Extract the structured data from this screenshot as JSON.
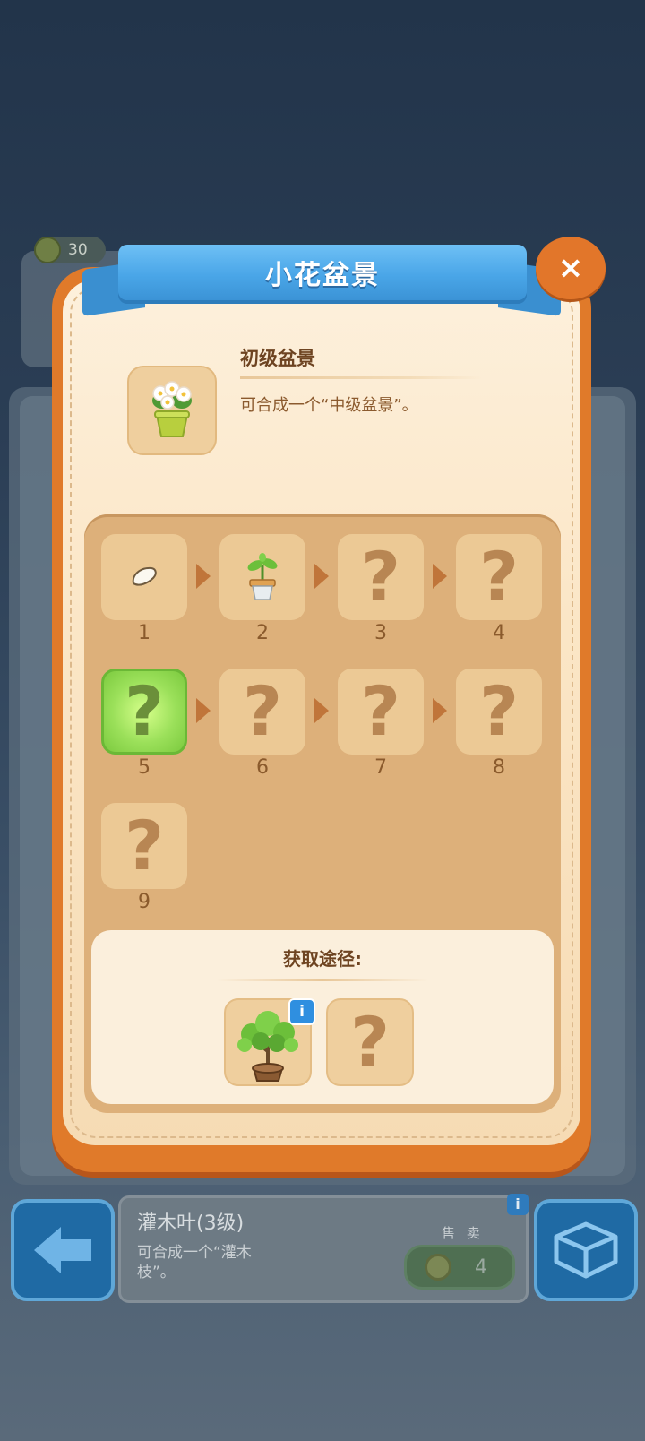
{
  "background": {
    "coin_count": "30"
  },
  "modal": {
    "title": "小花盆景",
    "close_label": "×",
    "item": {
      "name": "初级盆景",
      "description": "可合成一个“中级盆景”。",
      "icon": "flower-pot-icon"
    },
    "chain": {
      "unknown_glyph": "?",
      "steps": [
        {
          "number": "1",
          "icon": "seed-icon",
          "known": true
        },
        {
          "number": "2",
          "icon": "sprout-pot-icon",
          "known": true
        },
        {
          "number": "3",
          "known": false
        },
        {
          "number": "4",
          "known": false
        },
        {
          "number": "5",
          "known": false,
          "current": true
        },
        {
          "number": "6",
          "known": false
        },
        {
          "number": "7",
          "known": false
        },
        {
          "number": "8",
          "known": false
        },
        {
          "number": "9",
          "known": false
        }
      ]
    },
    "source": {
      "title": "获取途径:",
      "info_label": "i",
      "items": [
        {
          "icon": "potted-tree-icon",
          "known": true
        },
        {
          "known": false
        }
      ]
    }
  },
  "bottom": {
    "item_name": "灌木叶(3级)",
    "item_desc": "可合成一个“灌木枝”。",
    "sell_label": "售 卖",
    "sell_price": "4",
    "info_label": "i"
  },
  "colors": {
    "accent_orange": "#e07a2a",
    "ribbon_blue": "#4aa6e8",
    "panel_tan": "#ddb07a",
    "active_green": "#9be05a"
  }
}
